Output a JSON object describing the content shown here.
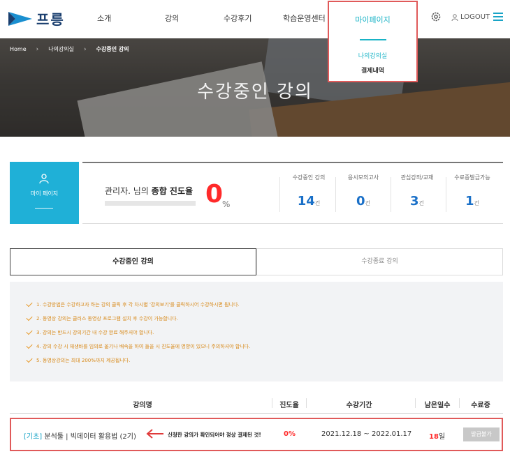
{
  "header": {
    "brand": "프릉",
    "nav": [
      "소개",
      "강의",
      "수강후기",
      "학습운영센터",
      "마이페이지"
    ],
    "dropdown": [
      "나의강의실",
      "결제내역"
    ],
    "logout": "LOGOUT"
  },
  "hero": {
    "breadcrumb": [
      "Home",
      "나의강의실",
      "수강중인 강의"
    ],
    "title": "수강중인 강의"
  },
  "mypage_box": {
    "label": "마이 페이지"
  },
  "summary": {
    "greeting_prefix": "관리자. 님의 ",
    "greeting_bold": "종합 진도율",
    "progress_value": "0",
    "progress_unit": "%",
    "progress_fraction": 0,
    "stats": [
      {
        "caption": "수강중인 강의",
        "value": "14",
        "unit": "건"
      },
      {
        "caption": "응시모의고사",
        "value": "0",
        "unit": "건"
      },
      {
        "caption": "관심강좌/교재",
        "value": "3",
        "unit": "건"
      },
      {
        "caption": "수료증발급가능",
        "value": "1",
        "unit": "건"
      }
    ]
  },
  "tabs": {
    "active": "수강중인 강의",
    "inactive": "수강종료 강의"
  },
  "notices": [
    "1. 수강방법은 수강하고자 하는 강의 클릭 후 각 차시별 '강의보기'를 클릭하시어 수강하시면 됩니다.",
    "2. 동영상 강의는 클러스 동영상 프로그램 설치 후 수강이 가능합니다.",
    "3. 강의는 반드시 강의기간 내 수강 완료 해주셔야 합니다.",
    "4. 강의 수강 시 재생바를 임의로 옮기나 배속을 하여 들을 시 진도율에 영향이 있으니 주의하셔야 합니다.",
    "5. 동영상강의는 최대 200%까지 제공됩니다."
  ],
  "table": {
    "headers": [
      "강의명",
      "진도율",
      "수강기간",
      "남은일수",
      "수료증"
    ],
    "row": {
      "tag": "[기초]",
      "course": "분석툴 | 빅데이터 활용법 (2기)",
      "note": "신청한 강의가 확인되어야 정상 결제된 것!",
      "progress": "0%",
      "period": "2021.12.18 ~ 2022.01.17",
      "remaining_num": "18",
      "remaining_unit": "일",
      "cert_button": "발급불가"
    }
  },
  "colors": {
    "accent": "#19b3c6",
    "highlight": "#e05a5a",
    "stat": "#1a70c8",
    "danger": "#ff2a2a"
  }
}
